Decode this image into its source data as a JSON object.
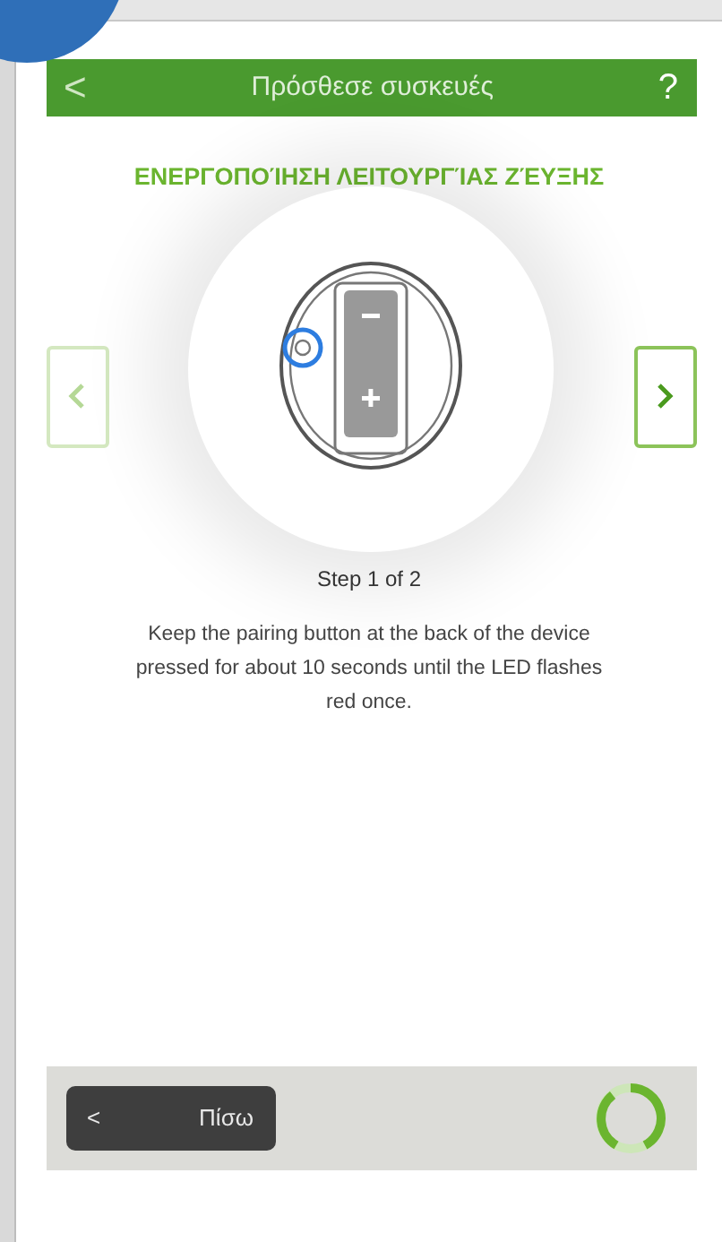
{
  "header": {
    "back": "<",
    "title": "Πρόσθεσε συσκευές",
    "help": "?"
  },
  "heading": "ΕΝΕΡΓΟΠΟΊΗΣΗ ΛΕΙΤΟΥΡΓΊΑΣ ΖΈΥΞΗΣ",
  "carousel": {
    "prev_disabled": true,
    "next_disabled": false
  },
  "step": "Step 1 of 2",
  "description": "Keep the pairing button at the back of the device pressed for about 10 seconds until the LED flashes red once.",
  "footer": {
    "back_button": "Πίσω",
    "back_arrow": "<"
  }
}
